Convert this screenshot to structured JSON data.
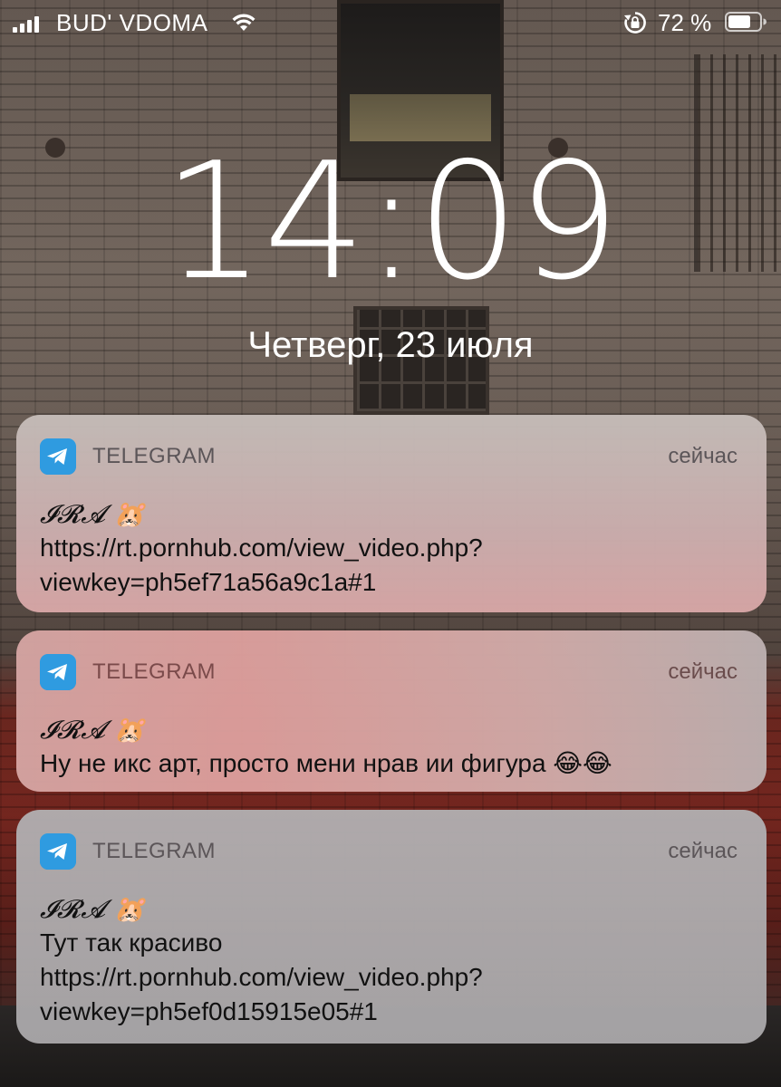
{
  "status_bar": {
    "carrier": "BUD' VDOMA",
    "battery_percent": "72 %",
    "signal_bars": 4,
    "icons": [
      "signal-icon",
      "wifi-icon",
      "rotation-lock-icon",
      "battery-icon"
    ]
  },
  "lock_screen": {
    "time": "14:09",
    "date": "Четверг, 23 июля"
  },
  "notifications": [
    {
      "app": "TELEGRAM",
      "time": "сейчас",
      "icon": "telegram-icon",
      "sender": "𝓘𝓡𝓐 🐹",
      "body": "https://rt.pornhub.com/view_video.php?\nviewkey=ph5ef71a56a9c1a#1"
    },
    {
      "app": "TELEGRAM",
      "time": "сейчас",
      "icon": "telegram-icon",
      "sender": "𝓘𝓡𝓐 🐹",
      "body": "Ну не икс арт, просто мени нрав ии фигура 😂😂"
    },
    {
      "app": "TELEGRAM",
      "time": "сейчас",
      "icon": "telegram-icon",
      "sender": "𝓘𝓡𝓐 🐹",
      "body": "Тут так красиво\nhttps://rt.pornhub.com/view_video.php?\nviewkey=ph5ef0d15915e05#1"
    }
  ],
  "colors": {
    "telegram_blue": "#2a8fd0",
    "status_text": "#ffffff"
  }
}
